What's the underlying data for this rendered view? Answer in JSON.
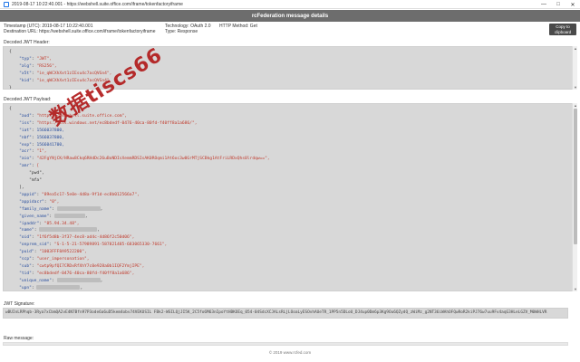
{
  "window": {
    "title": "2019-08-17 10:22:40.001 - https://webshell.suite.office.com/iframe/tokenfactoryiframe",
    "controls": [
      "—",
      "□",
      "✕"
    ]
  },
  "header": {
    "title": "rcFederation message details"
  },
  "meta": {
    "timestamp": "Timestamp (UTC): 2019-08-17 10:22:40.001",
    "destination": "Destination URL: https://webshell.suite.office.com/iframe/tokenfactoryiframe",
    "technology": "Technology: OAuth 2.0",
    "type": "Type: Response",
    "http_method": "HTTP Method: Get"
  },
  "copy_button": {
    "label_line1": "Copy to",
    "label_line2": "clipboard"
  },
  "jwt_header": {
    "label": "Decoded JWT Header:",
    "lines": [
      {
        "t": "{"
      },
      {
        "k": "\"typ\"",
        "v": "\"JWT\","
      },
      {
        "k": "\"alg\"",
        "v": "\"RS256\","
      },
      {
        "k": "\"x5t\"",
        "v": "\"ie_qWCXhXxt1zIEsu4c7acQVGn4\","
      },
      {
        "k": "\"kid\"",
        "v": "\"ie_qWCXhXxt1zIEsu4c7acQVGn4\""
      },
      {
        "t": "}"
      }
    ]
  },
  "jwt_payload": {
    "label": "Decoded JWT Payload:",
    "lines": [
      {
        "t": "{"
      },
      {
        "k": "\"aud\"",
        "v": "\"https://webshell.suite.office.com\","
      },
      {
        "k": "\"iss\"",
        "v": "\"https://sts.windows.net/ec8bdedf-0476-40ca-80fd-f40ff8a1a686/\","
      },
      {
        "k": "\"iat\"",
        "v": "1566037800,"
      },
      {
        "k": "\"nbf\"",
        "v": "1566037800,"
      },
      {
        "k": "\"exp\"",
        "v": "1566041700,"
      },
      {
        "k": "\"acr\"",
        "v": "\"1\","
      },
      {
        "k": "\"aio\"",
        "v": "\"42FgYNjCK/HRaw8Ckq6RHdDc26uBoNDIsXemmRDSIsAK0ROqmi1At6oc3w0GrMTjSCBkg1AtFriLRDxQhs0lrdqw==\","
      },
      {
        "k": "\"amr\"",
        "v": "["
      },
      {
        "t": "    \"pwd\","
      },
      {
        "t": "    \"mfa\""
      },
      {
        "t": "],"
      },
      {
        "k": "\"appid\"",
        "v": "\"89ea5c17-5e0e-4d8a-9f1d-ec8b012566a7\","
      },
      {
        "k": "\"appidacr\"",
        "v": "\"0\","
      },
      {
        "k": "\"family_name\"",
        "v": "REDACT_MED"
      },
      {
        "k": "\"given_name\"",
        "v": "REDACT_SHORT"
      },
      {
        "k": "\"ipaddr\"",
        "v": "\"85.94.34.48\","
      },
      {
        "k": "\"name\"",
        "v": "REDACT_LONG"
      },
      {
        "k": "\"oid\"",
        "v": "\"1f6f5d8b-3f37-4ec8-ad4c-4d86f2c50d06\","
      },
      {
        "k": "\"onprem_sid\"",
        "v": "\"S-1-5-21-57989891-587821485-683065330-7661\","
      },
      {
        "k": "\"puid\"",
        "v": "\"1003FFF8A9522200\","
      },
      {
        "k": "\"scp\"",
        "v": "\"user_impersonation\","
      },
      {
        "k": "\"sub\"",
        "v": "\"cwtp9pfQI7CRDxRfXhY7c0e928a0b1IQF2YmjIPE\","
      },
      {
        "k": "\"tid\"",
        "v": "\"ec8bdedf-0476-40ca-80fd-f40ff8a1a686\","
      },
      {
        "k": "\"unique_name\"",
        "v": "REDACT_MED"
      },
      {
        "k": "\"upn\"",
        "v": "REDACT_MED"
      },
      {
        "k": "\"uti\"",
        "v": "\"5IGFKNLpB56TjbO8KjAAA\","
      },
      {
        "k": "\"ver\"",
        "v": "\"1.0\""
      },
      {
        "t": "}"
      }
    ]
  },
  "signature": {
    "label": "JWT Signature:",
    "value": "wBUInLRPhqb-3Rya7xCbmQA2vE4N7Bfn97P3ode6a6uD5kem4obv74VEKUSIL FBk2-WSILQjJI5K_2C5fo6M63nIpoYtHBKOEq_054-04SdcXCJALsRLjLOoaLyESOvhAUeTR_1PP5n5DLoU_DJ4up0Dm6p3Kg9Ou6QZydQ_zWiMz_g2NT36iWAhOFQwRoR2kiPJ76w7uu9Fv4aqG3HLeLGZV_M0WHLVR"
  },
  "raw_message": {
    "label": "Raw message:"
  },
  "watermark": {
    "text": "数据tiscs66"
  },
  "footer": {
    "text": "© 2019 www.rcfed.com"
  }
}
